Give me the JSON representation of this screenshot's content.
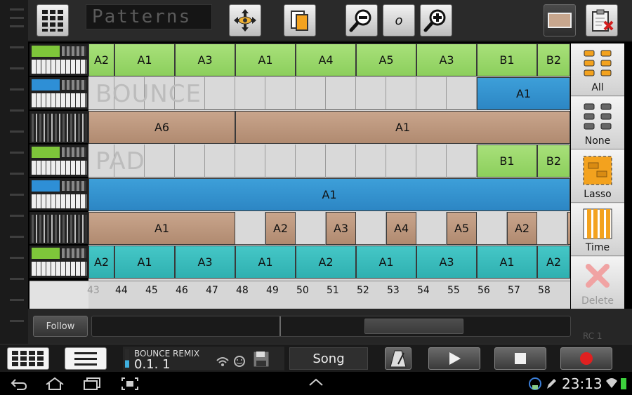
{
  "toolbar": {
    "patterns_label": "Patterns",
    "zoom_label": "o"
  },
  "tracks": [
    {
      "label": "",
      "blocks": [
        {
          "text": "A2",
          "color": "green"
        },
        {
          "text": "A1",
          "color": "green"
        },
        {
          "text": "A3",
          "color": "green"
        },
        {
          "text": "A1",
          "color": "green"
        },
        {
          "text": "A4",
          "color": "green"
        },
        {
          "text": "A5",
          "color": "green"
        },
        {
          "text": "A3",
          "color": "green"
        },
        {
          "text": "B1",
          "color": "green"
        },
        {
          "text": "B2",
          "color": "green"
        }
      ]
    },
    {
      "label": "BOUNCE",
      "blocks": [
        {
          "text": "A1",
          "color": "blue"
        }
      ]
    },
    {
      "label": "",
      "blocks": [
        {
          "text": "A6",
          "color": "tan"
        },
        {
          "text": "A1",
          "color": "tan"
        }
      ]
    },
    {
      "label": "PAD",
      "blocks": [
        {
          "text": "B1",
          "color": "green"
        },
        {
          "text": "B2",
          "color": "green"
        }
      ]
    },
    {
      "label": "",
      "blocks": [
        {
          "text": "A1",
          "color": "blue"
        }
      ]
    },
    {
      "label": "",
      "blocks": [
        {
          "text": "A1",
          "color": "tan"
        },
        {
          "text": "A2",
          "color": "tan"
        },
        {
          "text": "A3",
          "color": "tan"
        },
        {
          "text": "A4",
          "color": "tan"
        },
        {
          "text": "A5",
          "color": "tan"
        },
        {
          "text": "A2",
          "color": "tan"
        }
      ]
    },
    {
      "label": "",
      "blocks": [
        {
          "text": "A2",
          "color": "teal"
        },
        {
          "text": "A1",
          "color": "teal"
        },
        {
          "text": "A3",
          "color": "teal"
        },
        {
          "text": "A1",
          "color": "teal"
        },
        {
          "text": "A2",
          "color": "teal"
        },
        {
          "text": "A1",
          "color": "teal"
        },
        {
          "text": "A3",
          "color": "teal"
        },
        {
          "text": "A1",
          "color": "teal"
        },
        {
          "text": "A2",
          "color": "teal"
        }
      ]
    }
  ],
  "ruler": [
    "43",
    "44",
    "45",
    "46",
    "47",
    "48",
    "49",
    "50",
    "51",
    "52",
    "53",
    "54",
    "55",
    "56",
    "57",
    "58"
  ],
  "side_tools": {
    "all": "All",
    "none": "None",
    "lasso": "Lasso",
    "time": "Time",
    "delete": "Delete"
  },
  "scroller": {
    "follow": "Follow",
    "rc": "RC 1"
  },
  "transport": {
    "song_name": "BOUNCE REMIX",
    "position": "0.1. 1",
    "mode": "Song"
  },
  "system": {
    "time": "23:13"
  },
  "colors": {
    "green": "#9ad86a",
    "blue": "#3496d0",
    "tan": "#bd977d",
    "teal": "#3cbcbc",
    "record": "#e02020"
  }
}
